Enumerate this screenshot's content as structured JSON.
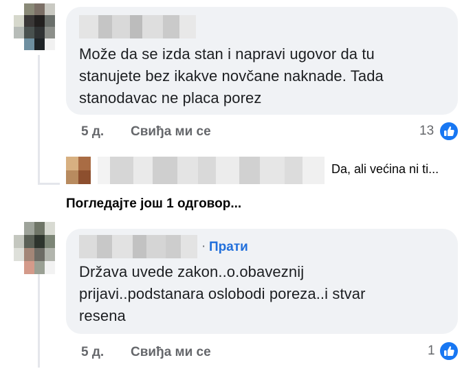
{
  "comments": [
    {
      "text_lines": [
        "Može da se izda stan i napravi ugovor da tu",
        "stanujete bez ikakve novčane naknade. Tada",
        "stanodavac ne placa porez"
      ],
      "time": "5 д.",
      "like_label": "Свиђа ми се",
      "reaction_count": "13",
      "reaction_icon": "like-icon"
    },
    {
      "follow_dot": "·",
      "follow_label": "Прати",
      "text_lines": [
        "Država uvede zakon..o.obaveznij",
        "prijavi..podstanara oslobodi poreza..i stvar",
        "resena"
      ],
      "time": "5 д.",
      "like_label": "Свиђа ми се",
      "reaction_count": "1",
      "reaction_icon": "like-icon"
    }
  ],
  "reply_preview": {
    "snippet": "Da, ali većina ni ti..."
  },
  "view_more_replies": "Погледајте још 1 одговор...",
  "colors": {
    "bubble": "#f0f2f5",
    "like_blue": "#1877f2",
    "meta_gray": "#65676b",
    "follow_blue": "#216fdb"
  }
}
